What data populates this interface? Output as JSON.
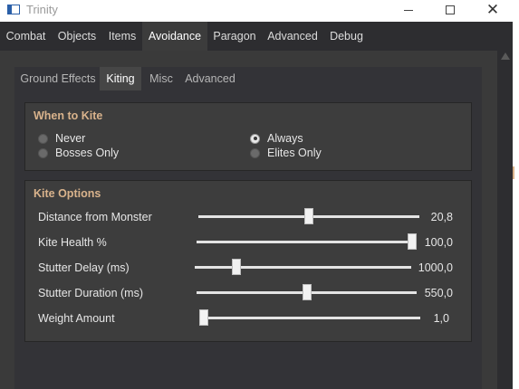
{
  "window": {
    "title": "Trinity"
  },
  "main_tabs": [
    {
      "label": "Combat",
      "active": false
    },
    {
      "label": "Objects",
      "active": false
    },
    {
      "label": "Items",
      "active": false
    },
    {
      "label": "Avoidance",
      "active": true
    },
    {
      "label": "Paragon",
      "active": false
    },
    {
      "label": "Advanced",
      "active": false
    },
    {
      "label": "Debug",
      "active": false
    }
  ],
  "sub_tabs": [
    {
      "label": "Ground Effects",
      "active": false
    },
    {
      "label": "Kiting",
      "active": true
    },
    {
      "label": "Misc",
      "active": false
    },
    {
      "label": "Advanced",
      "active": false
    }
  ],
  "when_to_kite": {
    "title": "When to Kite",
    "options": [
      {
        "label": "Never",
        "selected": false
      },
      {
        "label": "Bosses Only",
        "selected": false
      },
      {
        "label": "Always",
        "selected": true
      },
      {
        "label": "Elites Only",
        "selected": false
      }
    ]
  },
  "kite_options": {
    "title": "Kite Options",
    "sliders": [
      {
        "label": "Distance from Monster",
        "value": "20,8",
        "fraction": 0.5
      },
      {
        "label": "Kite Health %",
        "value": "100,0",
        "fraction": 1.0
      },
      {
        "label": "Stutter Delay (ms)",
        "value": "1000,0",
        "fraction": 0.18
      },
      {
        "label": "Stutter Duration (ms)",
        "value": "550,0",
        "fraction": 0.5
      },
      {
        "label": "Weight Amount",
        "value": "1,0",
        "fraction": 0.0
      }
    ]
  },
  "colors": {
    "accent_title": "#d9b38c",
    "window_bg": "#2d2d30",
    "active_tab": "#3c3c3c"
  },
  "icons": {
    "minimize": "minimize-icon",
    "maximize": "maximize-icon",
    "close": "close-icon",
    "app": "app-icon"
  }
}
